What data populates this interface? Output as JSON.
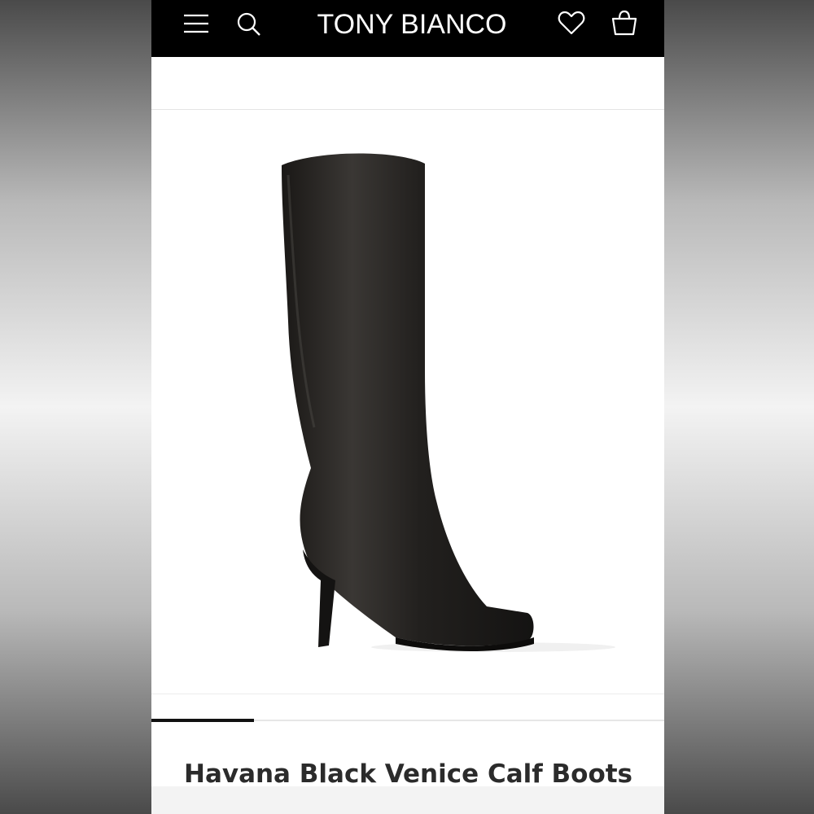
{
  "header": {
    "brand": "TONY BIANCO",
    "icons": {
      "menu": "hamburger-menu-icon",
      "search": "search-icon",
      "wishlist": "heart-icon",
      "cart": "shopping-bag-icon"
    }
  },
  "product": {
    "title": "Havana Black Venice Calf Boots",
    "image": "black-knee-high-boot"
  },
  "carousel": {
    "progress": 0.2
  },
  "colors": {
    "header_bg": "#000000",
    "page_bg": "#ffffff",
    "accent": "#111111"
  }
}
